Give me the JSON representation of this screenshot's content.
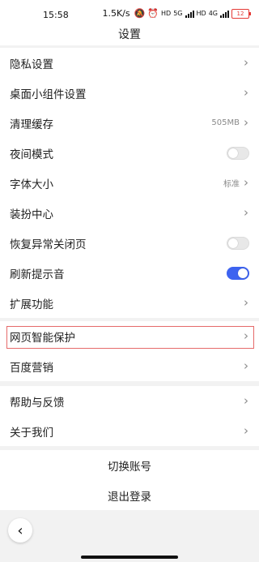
{
  "status_bar": {
    "time": "15:58",
    "net_speed": "1.5K/s",
    "hd1": "HD",
    "net1": "5G",
    "hd2": "HD",
    "net2": "4G",
    "battery": "12"
  },
  "header": {
    "title": "设置"
  },
  "settings": {
    "privacy": {
      "label": "隐私设置"
    },
    "widget": {
      "label": "桌面小组件设置"
    },
    "cache": {
      "label": "清理缓存",
      "value": "505MB"
    },
    "night_mode": {
      "label": "夜间模式",
      "enabled": false
    },
    "font_size": {
      "label": "字体大小",
      "value": "标准"
    },
    "decor": {
      "label": "装扮中心"
    },
    "restore": {
      "label": "恢复异常关闭页",
      "enabled": false
    },
    "refresh_sound": {
      "label": "刷新提示音",
      "enabled": true
    },
    "extensions": {
      "label": "扩展功能"
    },
    "web_protection": {
      "label": "网页智能保护"
    },
    "baidu_marketing": {
      "label": "百度营销"
    },
    "help": {
      "label": "帮助与反馈"
    },
    "about": {
      "label": "关于我们"
    }
  },
  "account": {
    "switch_label": "切换账号",
    "logout_label": "退出登录"
  },
  "nav": {
    "back_icon": "chevron-left-icon"
  },
  "colors": {
    "toggle_on": "#3d63f0",
    "highlight": "#e56a6a"
  }
}
